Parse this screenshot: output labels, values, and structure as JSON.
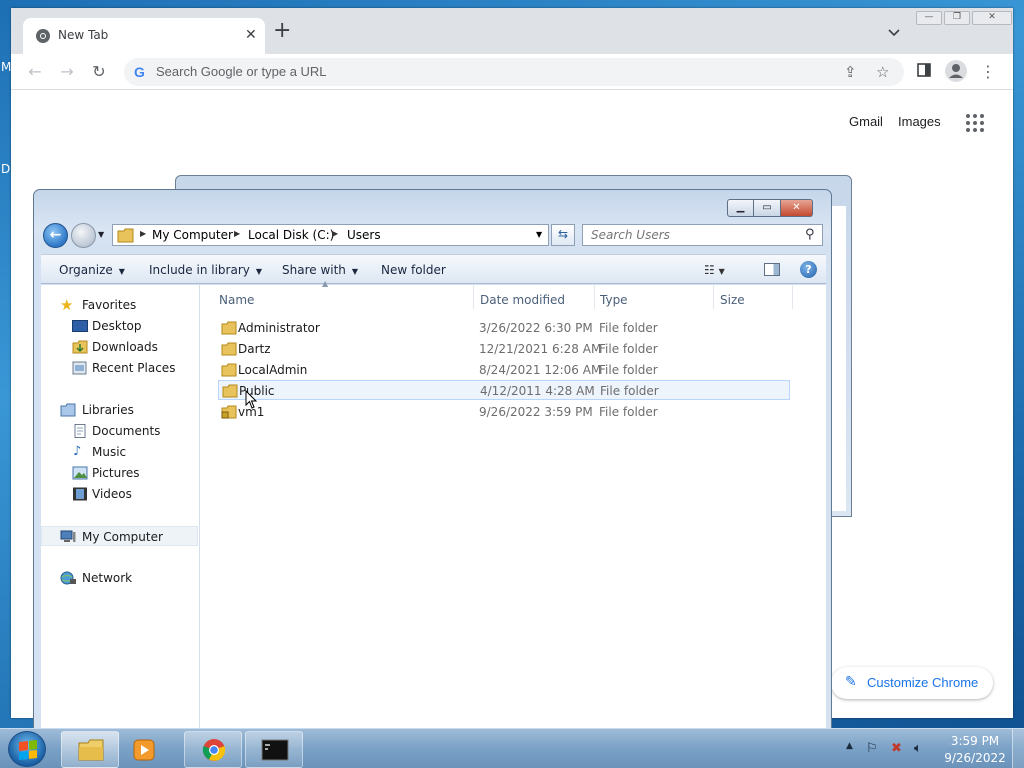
{
  "desktop": {
    "letters": [
      "M",
      "D"
    ]
  },
  "chrome": {
    "tab": {
      "title": "New Tab",
      "close": "✕"
    },
    "new_tab": "+",
    "omnibox": {
      "placeholder": "Search Google or type a URL"
    },
    "ntp_links": {
      "gmail": "Gmail",
      "images": "Images"
    },
    "customize": {
      "label": "Customize Chrome"
    },
    "window_controls": [
      "minimize",
      "restore",
      "close"
    ]
  },
  "explorer": {
    "breadcrumb": [
      "My Computer",
      "Local Disk (C:)",
      "Users"
    ],
    "search": {
      "placeholder": "Search Users"
    },
    "commands": {
      "organize": "Organize",
      "include": "Include in library",
      "share": "Share with",
      "new_folder": "New folder"
    },
    "nav": {
      "favorites": "Favorites",
      "desktop": "Desktop",
      "downloads": "Downloads",
      "recent": "Recent Places",
      "libraries": "Libraries",
      "documents": "Documents",
      "music": "Music",
      "pictures": "Pictures",
      "videos": "Videos",
      "my_computer": "My Computer",
      "network": "Network"
    },
    "columns": {
      "name": "Name",
      "date": "Date modified",
      "type": "Type",
      "size": "Size"
    },
    "files": [
      {
        "name": "Administrator",
        "date": "3/26/2022 6:30 PM",
        "type": "File folder"
      },
      {
        "name": "Dartz",
        "date": "12/21/2021 6:28 AM",
        "type": "File folder"
      },
      {
        "name": "LocalAdmin",
        "date": "8/24/2021 12:06 AM",
        "type": "File folder"
      },
      {
        "name": "Public",
        "date": "4/12/2011 4:28 AM",
        "type": "File folder"
      },
      {
        "name": "vm1",
        "date": "9/26/2022 3:59 PM",
        "type": "File folder"
      }
    ],
    "hovered_row": "Public"
  },
  "taskbar": {
    "apps": [
      "windows-explorer",
      "media-player",
      "google-chrome",
      "command-prompt"
    ],
    "clock": {
      "time": "3:59 PM",
      "date": "9/26/2022"
    }
  }
}
